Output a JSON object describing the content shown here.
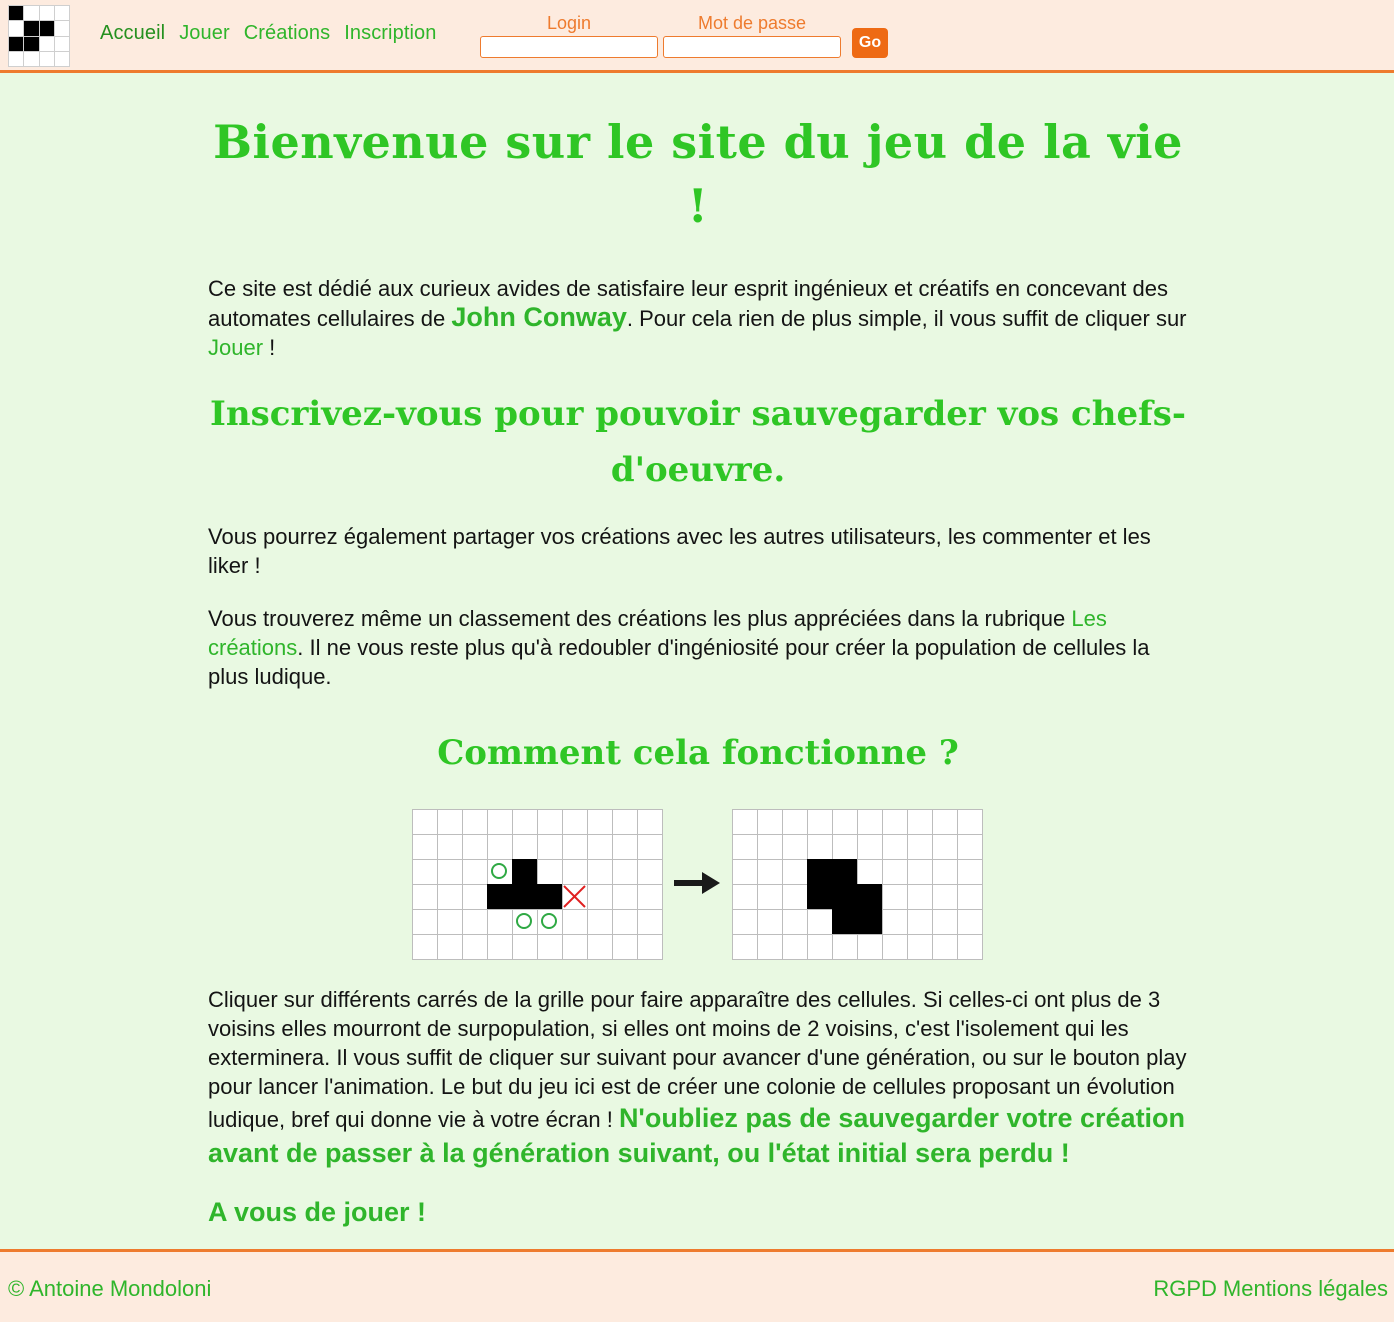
{
  "header": {
    "nav": [
      {
        "label": "Accueil",
        "active": true
      },
      {
        "label": "Jouer"
      },
      {
        "label": "Créations"
      },
      {
        "label": "Inscription"
      }
    ],
    "login_label": "Login",
    "password_label": "Mot de passe",
    "login_value": "",
    "password_value": "",
    "submit_label": "Go",
    "logo_icon": "game-of-life-logo-icon"
  },
  "main": {
    "title": "Bienvenue sur le site du jeu de la vie !",
    "intro": {
      "before": "Ce site est dédié aux curieux avides de satisfaire leur esprit ingénieux et créatifs en concevant des automates cellulaires de ",
      "conway_link": "John Conway",
      "middle": ". Pour cela rien de plus simple, il vous suffit de cliquer sur ",
      "play_link": "Jouer",
      "after": " !"
    },
    "signup_heading": "Inscrivez-vous pour pouvoir sauvegarder vos chefs-d'oeuvre.",
    "share_text": "Vous pourrez également partager vos créations avec les autres utilisateurs, les commenter et les liker !",
    "ranking": {
      "before": "Vous trouverez même un classement des créations les plus appréciées dans la rubrique ",
      "link": "Les créations",
      "after": ". Il ne vous reste plus qu'à redoubler d'ingéniosité pour créer la population de cellules la plus ludique."
    },
    "how_heading": "Comment cela fonctionne ?",
    "explanation": {
      "text": "Cliquer sur différents carrés de la grille pour faire apparaître des cellules. Si celles-ci ont plus de 3 voisins elles mourront de surpopulation, si elles ont moins de 2 voisins, c'est l'isolement qui les exterminera. Il vous suffit de cliquer sur suivant pour avancer d'une génération, ou sur le bouton play pour lancer l'animation. Le but du jeu ici est de créer une colonie de cellules proposant un évolution ludique, bref qui donne vie à votre écran ! ",
      "warning": "N'oubliez pas de sauvegarder votre création avant de passer à la génération suivant, ou l'état initial sera perdu !"
    },
    "your_turn": "A vous de jouer !",
    "colors": {
      "accent_green": "#2fc625",
      "link_green": "#2fb52b",
      "orange": "#ee7b2e",
      "background": "#e9f9e2",
      "header_bg": "#fdebdf"
    }
  },
  "footer": {
    "copyright": "© Antoine Mondoloni",
    "links": [
      "RGPD",
      "Mentions légales"
    ]
  }
}
